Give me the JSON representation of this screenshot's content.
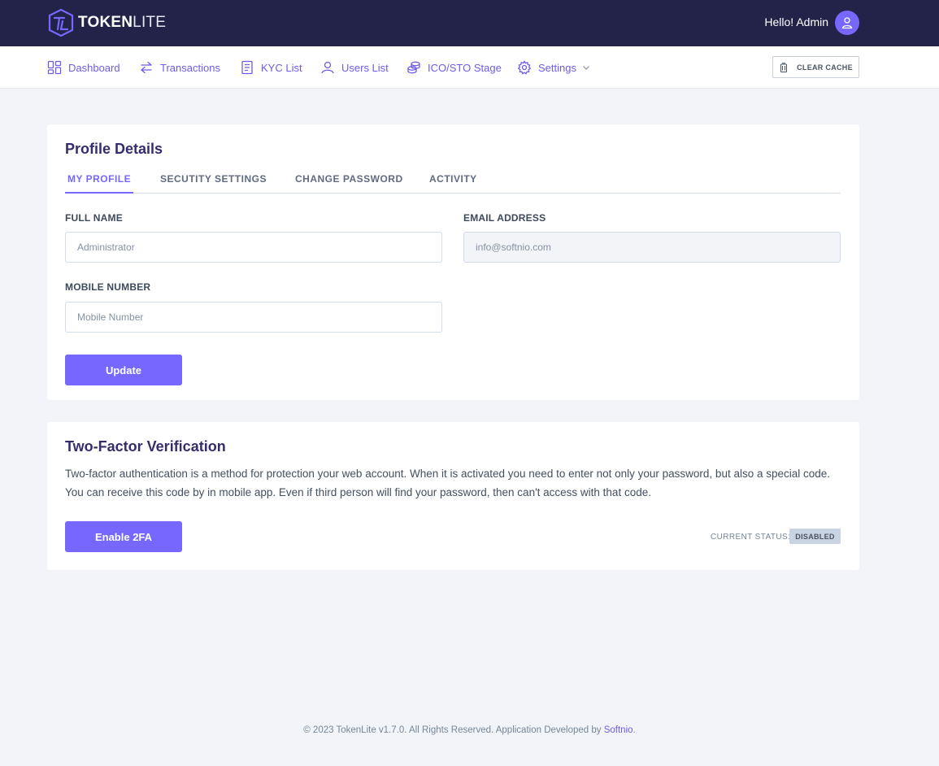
{
  "brand": {
    "name_bold": "TOKEN",
    "name_light": "LITE",
    "accent": "#7668fe",
    "topbar_bg": "#232349"
  },
  "header": {
    "greeting": "Hello! Admin",
    "avatar_icon": "user-icon"
  },
  "nav": {
    "items": [
      {
        "label": "Dashboard",
        "icon": "dashboard-icon"
      },
      {
        "label": "Transactions",
        "icon": "transfer-icon"
      },
      {
        "label": "KYC List",
        "icon": "document-list-icon"
      },
      {
        "label": "Users List",
        "icon": "users-icon"
      },
      {
        "label": "ICO/STO Stage",
        "icon": "coins-icon"
      },
      {
        "label": "Settings",
        "icon": "gear-icon"
      }
    ],
    "clear_cache": "CLEAR CACHE"
  },
  "profile": {
    "title": "Profile Details",
    "tabs": [
      {
        "label": "MY PROFILE",
        "active": true
      },
      {
        "label": "SECUTITY SETTINGS",
        "active": false
      },
      {
        "label": "CHANGE PASSWORD",
        "active": false
      },
      {
        "label": "ACTIVITY",
        "active": false
      }
    ],
    "full_name": {
      "label": "FULL NAME",
      "placeholder": "Administrator"
    },
    "email": {
      "label": "EMAIL ADDRESS",
      "placeholder": "info@softnio.com"
    },
    "mobile": {
      "label": "MOBILE NUMBER",
      "placeholder": "Mobile Number"
    },
    "update_button": "Update"
  },
  "twofa": {
    "title": "Two-Factor Verification",
    "description": "Two-factor authentication is a method for protection your web account. When it is activated you need to enter not only your password, but also a special code. You can receive this code by in mobile app. Even if third person will find your password, then can't access with that code.",
    "enable_button": "Enable 2FA",
    "status_label": "CURRENT STATUS:",
    "status_value": "DISABLED"
  },
  "footer": {
    "text": "© 2023 TokenLite v1.7.0. All Rights Reserved. Application Developed by",
    "link": "Softnio",
    "period": "."
  }
}
